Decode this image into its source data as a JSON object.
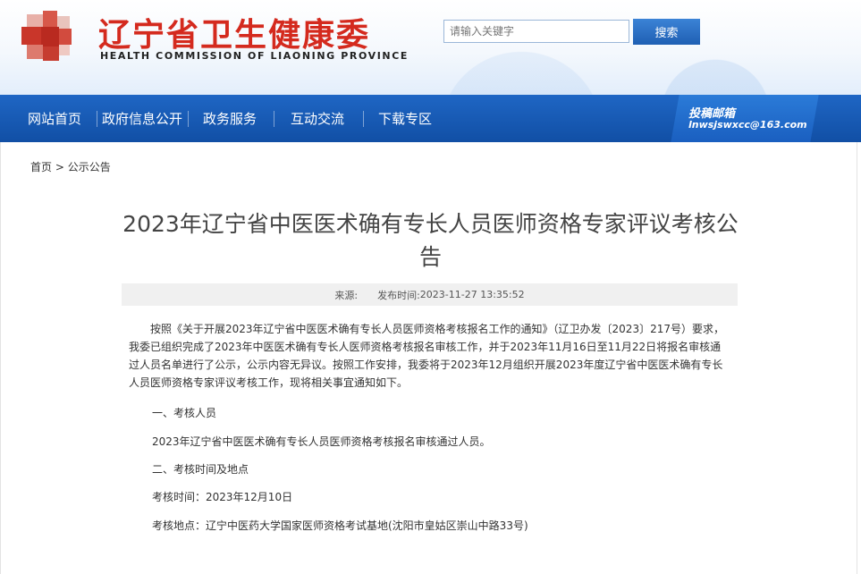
{
  "header": {
    "site_title": "辽宁省卫生健康委",
    "site_subtitle": "HEALTH COMMISSION OF LIAONING PROVINCE",
    "search_placeholder": "请输入关键字",
    "search_button": "搜索",
    "title_color": "#d42a1e"
  },
  "nav": {
    "items": [
      {
        "label": "网站首页"
      },
      {
        "label": "政府信息公开"
      },
      {
        "label": "政务服务"
      },
      {
        "label": "互动交流"
      },
      {
        "label": "下载专区"
      }
    ],
    "mail_label": "投稿邮箱",
    "mail_address": "lnwsjswxcc@163.com",
    "bar_color": "#1656b0"
  },
  "breadcrumb": {
    "home": "首页",
    "separator": ">",
    "current": "公示公告"
  },
  "article": {
    "title": "2023年辽宁省中医医术确有专长人员医师资格专家评议考核公告",
    "source_label": "来源:",
    "time_label": "发布时间:",
    "time_value": "2023-11-27 13:35:52",
    "para1": "按照《关于开展2023年辽宁省中医医术确有专长人员医师资格考核报名工作的通知》（辽卫办发〔2023〕217号）要求，我委已组织完成了2023年中医医术确有专长人医师资格考核报名审核工作，并于2023年11月16日至11月22日将报名审核通过人员名单进行了公示，公示内容无异议。按照工作安排，我委将于2023年12月组织开展2023年度辽宁省中医医术确有专长人员医师资格专家评议考核工作，现将相关事宜通知如下。",
    "section1": "一、考核人员",
    "section1_text": "2023年辽宁省中医医术确有专长人员医师资格考核报名审核通过人员。",
    "section2": "二、考核时间及地点",
    "exam_time": "考核时间：2023年12月10日",
    "exam_place": "考核地点：辽宁中医药大学国家医师资格考试基地(沈阳市皇姑区崇山中路33号)"
  }
}
